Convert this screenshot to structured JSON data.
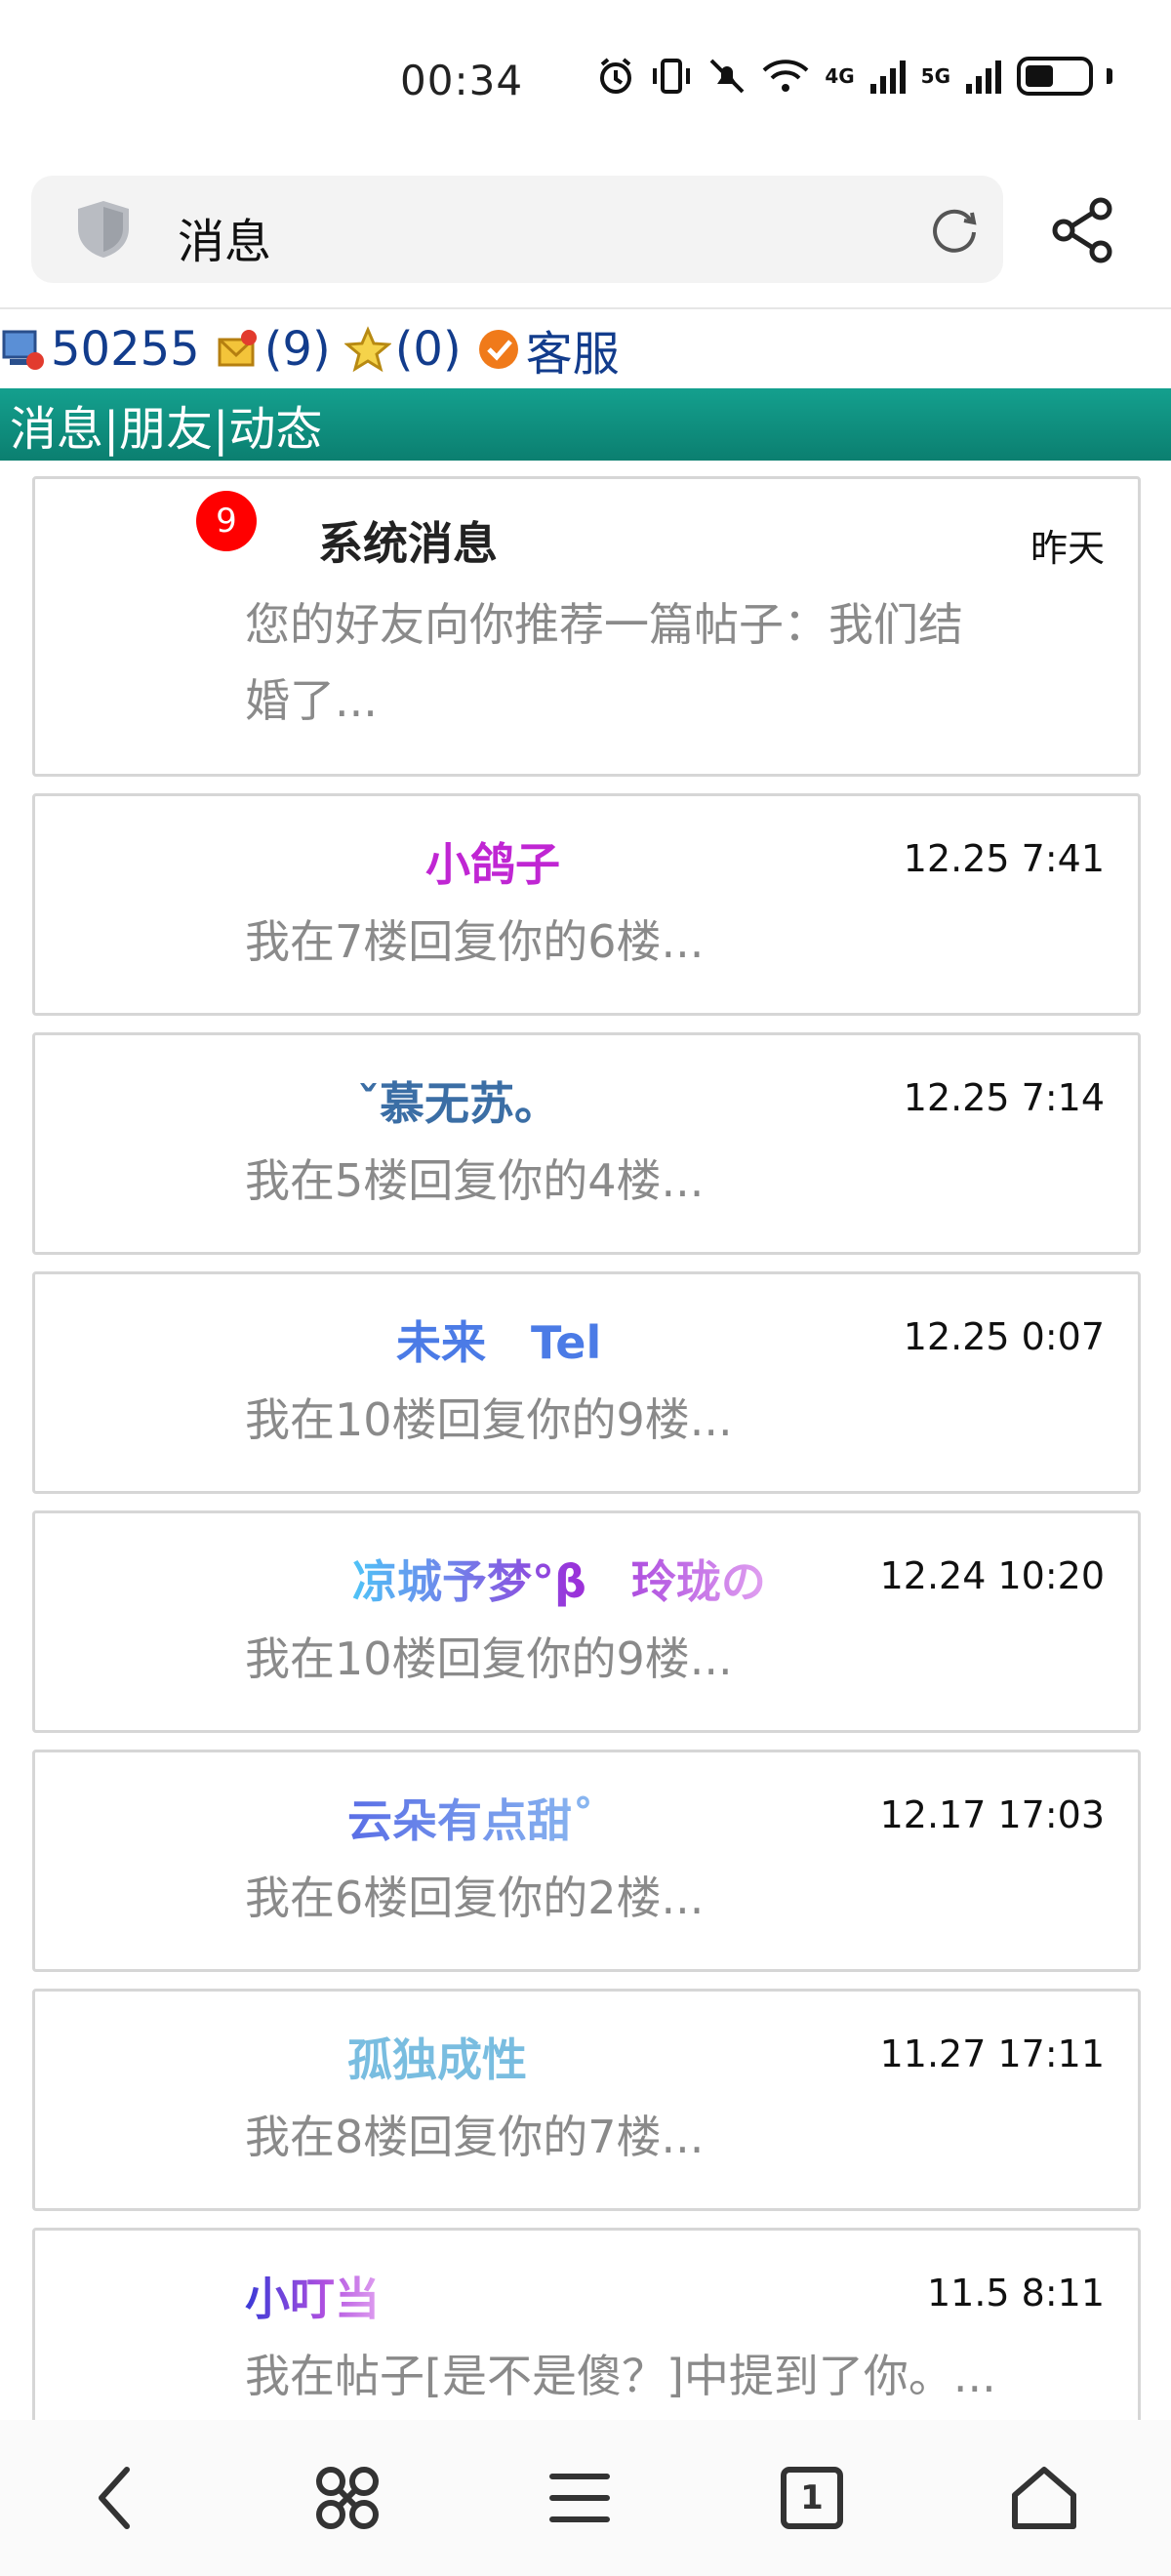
{
  "status_bar": {
    "time": "00:34",
    "icons": [
      "alarm-icon",
      "vibrate-icon",
      "mute-icon",
      "wifi-icon",
      "signal-4g-icon",
      "signal-5g-icon",
      "battery-icon"
    ],
    "net_labels": [
      "4G",
      "5G"
    ]
  },
  "address_bar": {
    "title": "消息"
  },
  "info_row": {
    "coins": "50255",
    "mail_count": "(9)",
    "star_count": "(0)",
    "service_label": "客服"
  },
  "tab_bar": {
    "label": "消息|朋友|动态"
  },
  "messages": [
    {
      "name": "系统消息",
      "time": "昨天",
      "preview_line1": "您的好友向你推荐一篇帖子：我们结",
      "preview_line2": "婚了...",
      "badge": "9",
      "name_color": "#222222"
    },
    {
      "name": "小鸽子",
      "time": "12.25 7:41",
      "preview_line1": "我在7楼回复你的6楼...",
      "name_color": "#c026d3"
    },
    {
      "name": "ˇ慕无苏。",
      "time": "12.25 7:14",
      "preview_line1": "我在5楼回复你的4楼...",
      "name_color": "#3b6ea5"
    },
    {
      "name": "未来　Tel",
      "time": "12.25 0:07",
      "preview_line1": "我在10楼回复你的9楼...",
      "name_color": "#4b7be6"
    },
    {
      "name": "凉城予梦°β　玲珑の",
      "time": "12.24 10:20",
      "preview_line1": "我在10楼回复你的9楼...",
      "name_color": "#9b30d9"
    },
    {
      "name": "云朵有点甜˚",
      "time": "12.17 17:03",
      "preview_line1": "我在6楼回复你的2楼...",
      "name_color": "#6a78e6"
    },
    {
      "name": "孤独成性",
      "time": "11.27 17:11",
      "preview_line1": "我在8楼回复你的7楼...",
      "name_color": "#79bde0"
    },
    {
      "name": "小叮当",
      "time": "11.5 8:11",
      "preview_line1": "我在帖子[是不是傻？]中提到了你。...",
      "name_color": "#6a5ae0"
    }
  ],
  "bottom_nav": {
    "items": [
      "back-icon",
      "apps-icon",
      "menu-icon",
      "tabs-icon",
      "home-icon"
    ],
    "tab_count": "1"
  }
}
